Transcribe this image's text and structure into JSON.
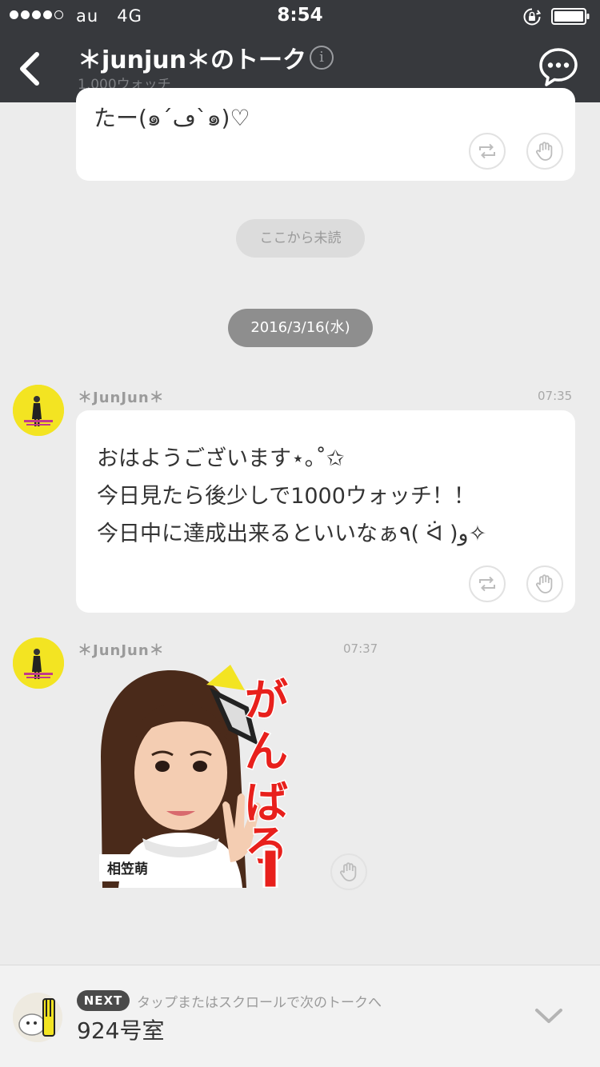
{
  "status_bar": {
    "carrier": "au",
    "network": "4G",
    "time": "8:54",
    "signal_dots_filled": 4,
    "signal_dots_total": 5
  },
  "header": {
    "title": "＊junjun＊のトーク",
    "subtitle": "1,000ウォッチ",
    "back_icon": "chevron-left-icon",
    "info_icon": "info-icon",
    "info_label": "i",
    "chat_icon": "chat-bubble-dots-icon"
  },
  "messages": [
    {
      "text": "たー(๑´ڡ`๑)♡",
      "actions": [
        "repost-icon",
        "hand-icon"
      ]
    },
    {
      "author": "＊JunJun＊",
      "time": "07:35",
      "lines": [
        "おはようございます⋆｡˚✩",
        "今日見たら後少しで1000ウォッチ！！",
        "今日中に達成出来るといいなぁ٩( ᐛ )و✧"
      ],
      "actions": [
        "repost-icon",
        "hand-icon"
      ]
    },
    {
      "author": "＊JunJun＊",
      "time": "07:37",
      "sticker": {
        "caption": "がんばろー",
        "name_tag": "相笠萌"
      },
      "actions": [
        "hand-icon"
      ]
    }
  ],
  "unread_marker": "ここから未読",
  "date_marker": "2016/3/16(水)",
  "next_bar": {
    "badge": "NEXT",
    "hint": "タップまたはスクロールで次のトークへ",
    "room": "924号室",
    "icon": "chevron-down-icon"
  },
  "colors": {
    "header_bg": "#37393d",
    "chat_bg": "#ececec",
    "date_pill": "#8e8e8e",
    "unread_pill": "#dcdcdc",
    "avatar_yellow": "#f3e422",
    "sticker_red": "#e8201c"
  }
}
